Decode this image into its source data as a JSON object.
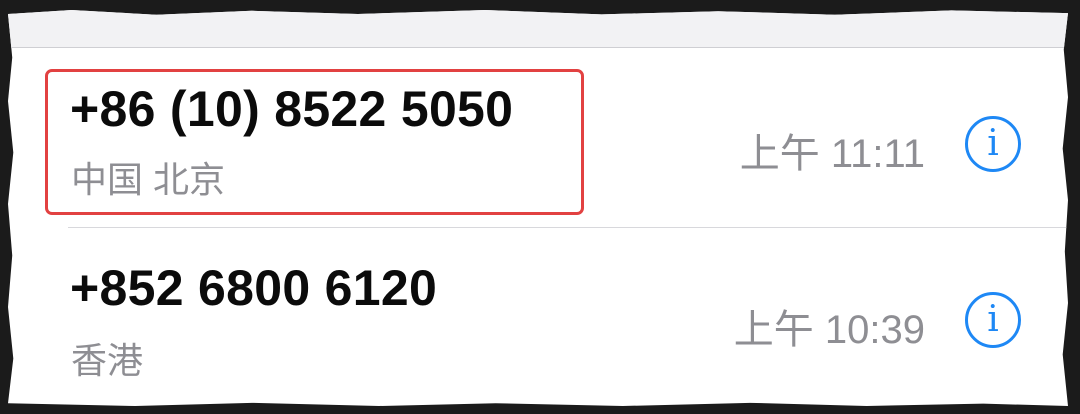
{
  "calls": [
    {
      "number": "+86 (10) 8522 5050",
      "location": "中国 北京",
      "time": "上午 11:11",
      "info_icon": "i"
    },
    {
      "number": "+852 6800 6120",
      "location": "香港",
      "time": "上午 10:39",
      "info_icon": "i"
    }
  ],
  "colors": {
    "accent": "#1e88f5",
    "highlight": "#e24141",
    "secondary_text": "#8e8e93"
  }
}
